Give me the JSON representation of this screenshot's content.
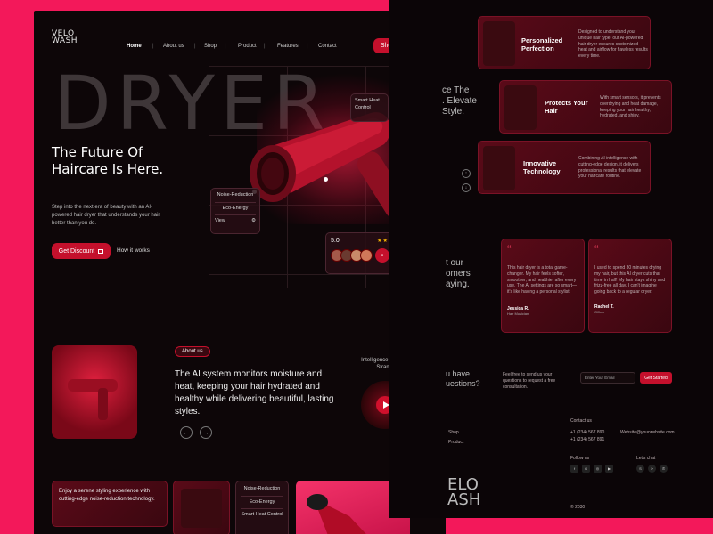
{
  "brand": {
    "logo_line1": "VELO",
    "logo_line2": "WASH"
  },
  "nav": {
    "items": [
      "Home",
      "About us",
      "Shop",
      "Product",
      "Features",
      "Contact"
    ],
    "shop_button": "Shop"
  },
  "hero": {
    "big_word": "DRYER",
    "headline_line1": "The Future Of",
    "headline_line2": "Haircare Is Here.",
    "description": "Step into the next era of beauty with an AI-powered hair dryer that understands your hair better than you do.",
    "cta_primary": "Get Discount",
    "cta_secondary": "How it works",
    "tag_smart_heat": "Smart Heat Control",
    "tag_noise": "Noise-Reduction",
    "tag_eco": "Eco-Energy",
    "tag_view": "View",
    "rating_value": "5.0",
    "rating_stars": 5
  },
  "about": {
    "badge": "About us",
    "text": "The AI system monitors moisture and heat, keeping your hair hydrated and healthy while delivering beautiful, lasting styles.",
    "video_caption": "Intelligence in Every Strand."
  },
  "bottom": {
    "card_text": "Enjoy a serene styling experience with cutting-edge noise-reduction technology.",
    "chips": [
      "Noise-Reduction",
      "Eco-Energy",
      "Smart Heat Control"
    ]
  },
  "right": {
    "features": [
      {
        "title": "Personalized Perfection",
        "desc": "Designed to understand your unique hair type, our AI-powered hair dryer ensures customized heat and airflow for flawless results every time."
      },
      {
        "title": "Protects Your Hair",
        "desc": "With smart sensors, it prevents overdrying and heat damage, keeping your hair healthy, hydrated, and shiny."
      },
      {
        "title": "Innovative Technology",
        "desc": "Combining AI intelligence with cutting-edge design, it delivers professional results that elevate your haircare routine."
      }
    ],
    "partial_heading_1": [
      "ce The",
      ". Elevate",
      "Style."
    ],
    "partial_heading_2": [
      "t our",
      "omers",
      "aying."
    ],
    "testimonials": [
      {
        "quote": "This hair dryer is a total game-changer. My hair feels softer, smoother, and healthier after every use. The AI settings are so smart—it's like having a personal stylist!",
        "name": "Jessica R.",
        "role": "Hair Musician"
      },
      {
        "quote": "I used to spend 30 minutes drying my hair, but this AI dryer cuts that time in half! My hair stays shiny and frizz-free all day. I can't imagine going back to a regular dryer.",
        "name": "Rachel T.",
        "role": "Officer"
      }
    ],
    "questions_heading": [
      "u have",
      "uestions?"
    ],
    "questions_text": "Feel free to send us your questions to request a free consultation.",
    "email_placeholder": "Enter Your Email",
    "get_started": "Get Started",
    "footer_links": [
      "Shop",
      "Product"
    ],
    "contact_label": "Contact us",
    "phones": [
      "+1 (234) 567 890",
      "+1 (234) 567 891"
    ],
    "email": "Website@yourwebsite.com",
    "follow_label": "Follow us",
    "chat_label": "Let's chat",
    "footer_logo_1": "ELO",
    "footer_logo_2": "ASH",
    "copyright": "© 2030"
  },
  "colors": {
    "accent": "#c4102c",
    "background": "#f3185a",
    "panel": "#0d0608"
  }
}
